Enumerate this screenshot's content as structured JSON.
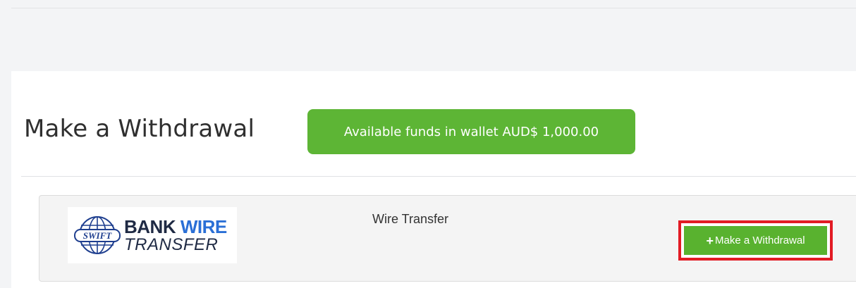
{
  "page": {
    "title": "Make a Withdrawal",
    "funds_badge": "Available funds in wallet AUD$ 1,000.00"
  },
  "method": {
    "logo": {
      "emblem": "SWIFT",
      "line1_a": "BANK",
      "line1_b": "WIRE",
      "line2": "TRANSFER"
    },
    "name": "Wire Transfer",
    "button_label": "Make a Withdrawal",
    "button_icon": "plus-icon"
  },
  "colors": {
    "accent_green": "#5db535",
    "highlight_red": "#e21b24"
  }
}
